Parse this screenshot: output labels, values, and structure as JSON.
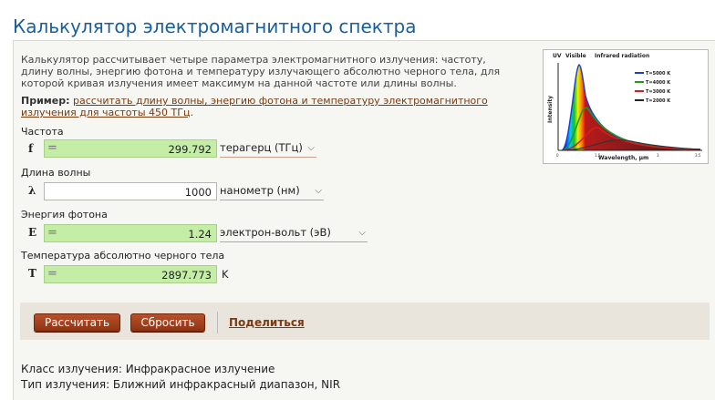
{
  "title": "Калькулятор электромагнитного спектра",
  "description": "Калькулятор рассчитывает четыре параметра электромагнитного излучения: частоту, длину волны, энергию фотона и температуру излучающего абсолютно черного тела, для которой кривая излучения имеет максимум на данной частоте или длины волны.",
  "example": {
    "prefix": "Пример:",
    "link_text": "рассчитать длину волны, энергию фотона и температуру электромагнитного излучения для частоты 450 ТГц",
    "suffix": "."
  },
  "spectrum_image": {
    "uv_label": "UV",
    "visible_label": "Visible",
    "infrared_label": "Infrared radiation",
    "y_label": "Intensity",
    "x_label": "Wavelength, μm",
    "legend": [
      {
        "label": "T=5000 K",
        "color": "#1b3bd8"
      },
      {
        "label": "T=4000 K",
        "color": "#1d9a2a"
      },
      {
        "label": "T=3000 K",
        "color": "#d02020"
      },
      {
        "label": "T=2000 K",
        "color": "#222222"
      }
    ],
    "ticks": [
      "0",
      "1.5",
      "3",
      "3.5"
    ]
  },
  "fields": {
    "frequency": {
      "label": "Частота",
      "symbol": "f",
      "prefix": "=",
      "value": "299.792",
      "unit": "терагерц (ТГц)"
    },
    "wavelength": {
      "label": "Длина волны",
      "symbol": "λ",
      "value": "1000",
      "unit": "нанометр (нм)"
    },
    "energy": {
      "label": "Энергия фотона",
      "symbol": "E",
      "prefix": "=",
      "value": "1.24",
      "unit": "электрон-вольт (эВ)"
    },
    "temperature": {
      "label": "Температура абсолютно черного тела",
      "symbol": "T",
      "prefix": "=",
      "value": "2897.773",
      "unit": "K"
    }
  },
  "buttons": {
    "calculate": "Рассчитать",
    "reset": "Сбросить",
    "share": "Поделиться"
  },
  "results": {
    "class_line": "Класс излучения: Инфракрасное излучение",
    "type_line": "Тип излучения: Ближний инфракрасный диапазон, NIR"
  },
  "colors": {
    "title": "#1a5e9c",
    "calculated_field": "#c4eea6",
    "button": "#9c3c18",
    "link": "#7a3b10"
  }
}
